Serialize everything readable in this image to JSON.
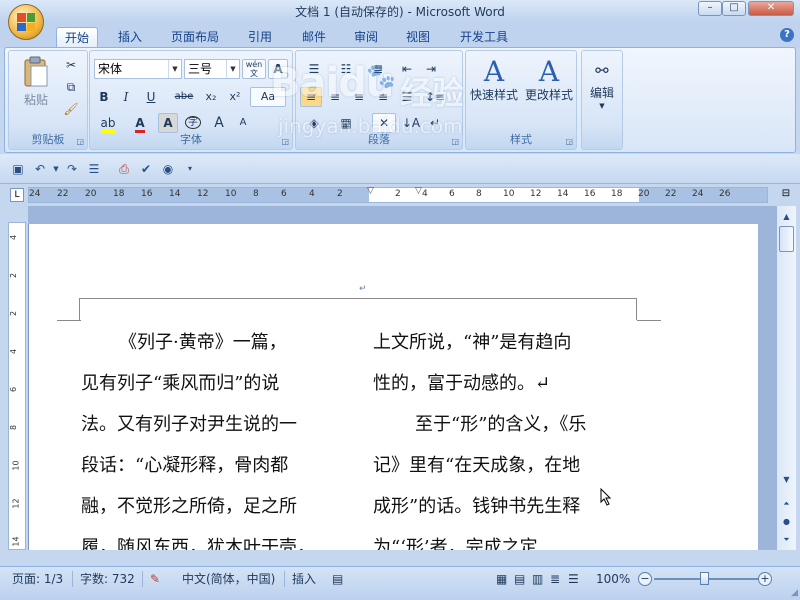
{
  "window": {
    "title": "文档 1 (自动保存的) - Microsoft Word",
    "min": "–",
    "max": "□",
    "close": "✕"
  },
  "tabs": [
    {
      "label": "开始",
      "active": true
    },
    {
      "label": "插入"
    },
    {
      "label": "页面布局"
    },
    {
      "label": "引用"
    },
    {
      "label": "邮件"
    },
    {
      "label": "审阅"
    },
    {
      "label": "视图"
    },
    {
      "label": "开发工具"
    }
  ],
  "help": "?",
  "ribbon": {
    "clipboard": {
      "label": "剪贴板",
      "paste": "粘贴"
    },
    "font": {
      "label": "字体",
      "name": "宋体",
      "size": "三号",
      "wen": "wén\n文",
      "A": "A",
      "bold": "B",
      "italic": "I",
      "underline": "U",
      "strike": "abe",
      "sub": "x₂",
      "sup": "x²",
      "fontcolor": "A",
      "charshade": "A",
      "circle": "字",
      "grow": "A",
      "shrink": "A",
      "aa": "Aa"
    },
    "paragraph": {
      "label": "段落"
    },
    "styles": {
      "label": "样式",
      "quick": "快速样式",
      "change": "更改样式"
    },
    "editing": {
      "label": "编辑"
    }
  },
  "watermark": {
    "brand": "Baidu",
    "tag": "经验",
    "url": "jingyan.baidu.com"
  },
  "ruler": {
    "left_ticks": [
      "24",
      "22",
      "20",
      "18",
      "16",
      "14",
      "12",
      "10",
      "8",
      "6",
      "4",
      "2"
    ],
    "right_ticks": [
      "2",
      "4",
      "6",
      "8",
      "10",
      "12",
      "14",
      "16",
      "18",
      "20",
      "22",
      "24",
      "26"
    ],
    "v_ticks": [
      "4",
      "2",
      "2",
      "4",
      "6",
      "8",
      "10",
      "12",
      "14"
    ]
  },
  "document": {
    "header_para_mark": "↵",
    "col1": [
      "《列子·黄帝》一篇，",
      "见有列子“乘风而归”的说",
      "法。又有列子对尹生说的一",
      "段话：“心凝形释，骨肉都",
      "融，不觉形之所倚，足之所",
      "履，随风东西，犹木叶干壳，"
    ],
    "col2": [
      "上文所说，“神”是有趋向",
      "性的，富于动感的。↵",
      "至于“形”的含义，《乐",
      "记》里有“在天成象，在地",
      "成形”的话。钱钟书先生释",
      "为“‘形’者，完成之定"
    ]
  },
  "status": {
    "page": "页面: 1/3",
    "words": "字数: 732",
    "lang": "中文(简体，中国)",
    "mode": "插入",
    "zoom": "100%",
    "minus": "−",
    "plus": "+"
  }
}
